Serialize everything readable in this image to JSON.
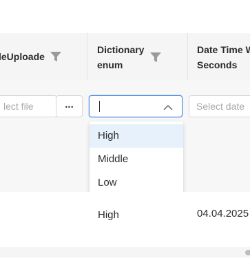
{
  "headers": {
    "file_upload": "leUploade",
    "dictionary_line1": "Dictionary",
    "dictionary_line2": "enum",
    "datetime_line1": "Date Time W",
    "datetime_line2": "Seconds"
  },
  "filters": {
    "file_placeholder": "lect file",
    "file_button": "...",
    "dictionary_value": "",
    "date_placeholder": "Select date"
  },
  "dropdown": {
    "options": [
      "High",
      "Middle",
      "Low"
    ],
    "highlighted": "High"
  },
  "row": {
    "dictionary": "High",
    "datetime": "04.04.2025"
  },
  "icons": {
    "filter": "filter-icon",
    "chevron": "chevron-up-icon"
  }
}
